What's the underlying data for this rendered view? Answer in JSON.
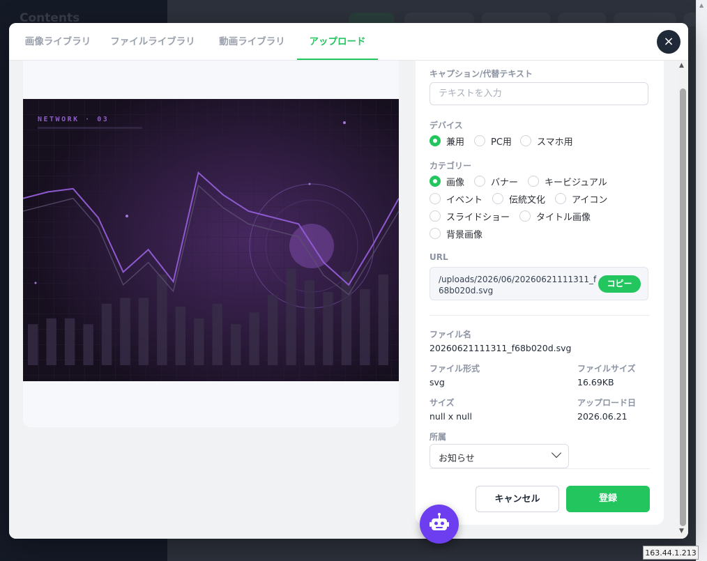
{
  "background": {
    "app_title": "Contents"
  },
  "tabs": [
    {
      "label": "画像ライブラリ",
      "active": false
    },
    {
      "label": "ファイルライブラリ",
      "active": false
    },
    {
      "label": "動画ライブラリ",
      "active": false
    },
    {
      "label": "アップロード",
      "active": true
    }
  ],
  "preview": {
    "image_title": "NETWORK · 03",
    "bars": [
      14,
      16,
      16,
      14,
      21,
      23,
      23,
      31,
      20,
      16,
      21,
      14,
      18,
      24,
      33,
      29,
      25,
      32,
      26,
      31
    ],
    "line_main": [
      44,
      46,
      47,
      38,
      21,
      28,
      18,
      52,
      45,
      40,
      38,
      36,
      24,
      17,
      30,
      44
    ],
    "line_shadow": [
      40,
      42,
      44,
      35,
      17,
      24,
      15,
      48,
      41,
      36,
      34,
      32,
      20,
      14,
      27,
      40
    ]
  },
  "form": {
    "caption_label": "キャプション/代替テキスト",
    "caption_placeholder": "テキストを入力",
    "caption_value": "",
    "device_label": "デバイス",
    "device_options": [
      {
        "label": "兼用",
        "checked": true
      },
      {
        "label": "PC用",
        "checked": false
      },
      {
        "label": "スマホ用",
        "checked": false
      }
    ],
    "category_label": "カテゴリー",
    "category_options": [
      {
        "label": "画像",
        "checked": true
      },
      {
        "label": "バナー",
        "checked": false
      },
      {
        "label": "キービジュアル",
        "checked": false
      },
      {
        "label": "イベント",
        "checked": false
      },
      {
        "label": "伝統文化",
        "checked": false
      },
      {
        "label": "アイコン",
        "checked": false
      },
      {
        "label": "スライドショー",
        "checked": false
      },
      {
        "label": "タイトル画像",
        "checked": false
      },
      {
        "label": "背景画像",
        "checked": false
      }
    ],
    "url_label": "URL",
    "url_value": "/uploads/2026/06/20260621111311_f68b020d.svg",
    "copy_label": "コピー"
  },
  "file_info": {
    "filename_label": "ファイル名",
    "filename_value": "20260621111311_f68b020d.svg",
    "format_label": "ファイル形式",
    "format_value": "svg",
    "filesize_label": "ファイルサイズ",
    "filesize_value": "16.69KB",
    "size_label": "サイズ",
    "size_value": "null x null",
    "uploaded_label": "アップロード日",
    "uploaded_value": "2026.06.21",
    "affiliation_label": "所属",
    "affiliation_value": "お知らせ"
  },
  "actions": {
    "cancel_label": "キャンセル",
    "save_label": "登録"
  },
  "ip_address": "163.44.1.213",
  "colors": {
    "accent": "#22c55e",
    "robot": "#6d3ef0",
    "close_bg": "#1f2937"
  }
}
